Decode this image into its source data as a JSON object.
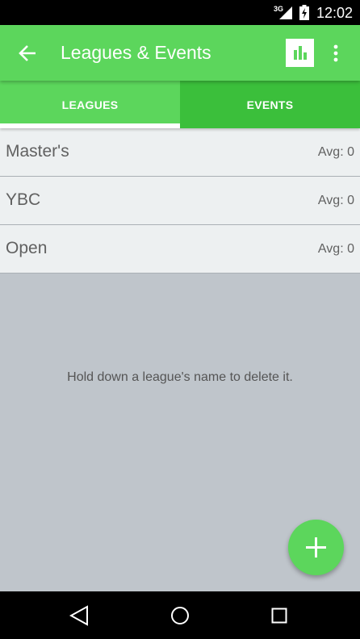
{
  "status_bar": {
    "network": "3G",
    "time": "12:02"
  },
  "app_bar": {
    "title": "Leagues & Events"
  },
  "tabs": [
    {
      "label": "LEAGUES",
      "selected": true
    },
    {
      "label": "EVENTS",
      "selected": false
    }
  ],
  "leagues": [
    {
      "name": "Master's",
      "avg": "Avg: 0"
    },
    {
      "name": "YBC",
      "avg": "Avg: 0"
    },
    {
      "name": "Open",
      "avg": "Avg: 0"
    }
  ],
  "hint": "Hold down a league's name to delete it.",
  "colors": {
    "primary": "#5cd65c",
    "primary_dark": "#3bbf3b",
    "list_background": "#edf0f1",
    "empty_background": "#bfc5cb"
  },
  "icons": {
    "back": "arrow-back-icon",
    "stats": "bar-chart-icon",
    "overflow": "more-vert-icon",
    "fab": "add-icon"
  }
}
